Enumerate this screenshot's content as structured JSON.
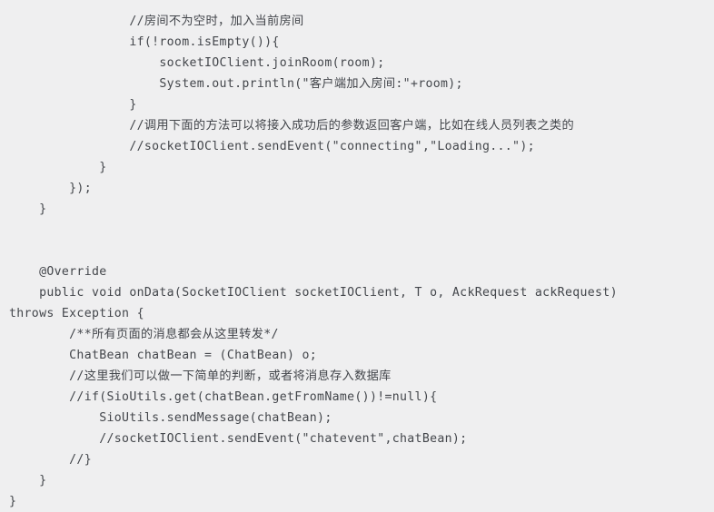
{
  "editor": {
    "background_color": "#efeff0",
    "text_color": "#43464b",
    "language": "java",
    "font_kind": "monospace"
  },
  "code": {
    "lines": [
      "                //房间不为空时，加入当前房间",
      "                if(!room.isEmpty()){",
      "                    socketIOClient.joinRoom(room);",
      "                    System.out.println(\"客户端加入房间:\"+room);",
      "                }",
      "                //调用下面的方法可以将接入成功后的参数返回客户端，比如在线人员列表之类的",
      "                //socketIOClient.sendEvent(\"connecting\",\"Loading...\");",
      "            }",
      "        });",
      "    }",
      "",
      "",
      "    @Override",
      "    public void onData(SocketIOClient socketIOClient, T o, AckRequest ackRequest)",
      "throws Exception {",
      "        /**所有页面的消息都会从这里转发*/",
      "        ChatBean chatBean = (ChatBean) o;",
      "        //这里我们可以做一下简单的判断，或者将消息存入数据库",
      "        //if(SioUtils.get(chatBean.getFromName())!=null){",
      "            SioUtils.sendMessage(chatBean);",
      "            //socketIOClient.sendEvent(\"chatevent\",chatBean);",
      "        //}",
      "    }",
      "}"
    ]
  }
}
